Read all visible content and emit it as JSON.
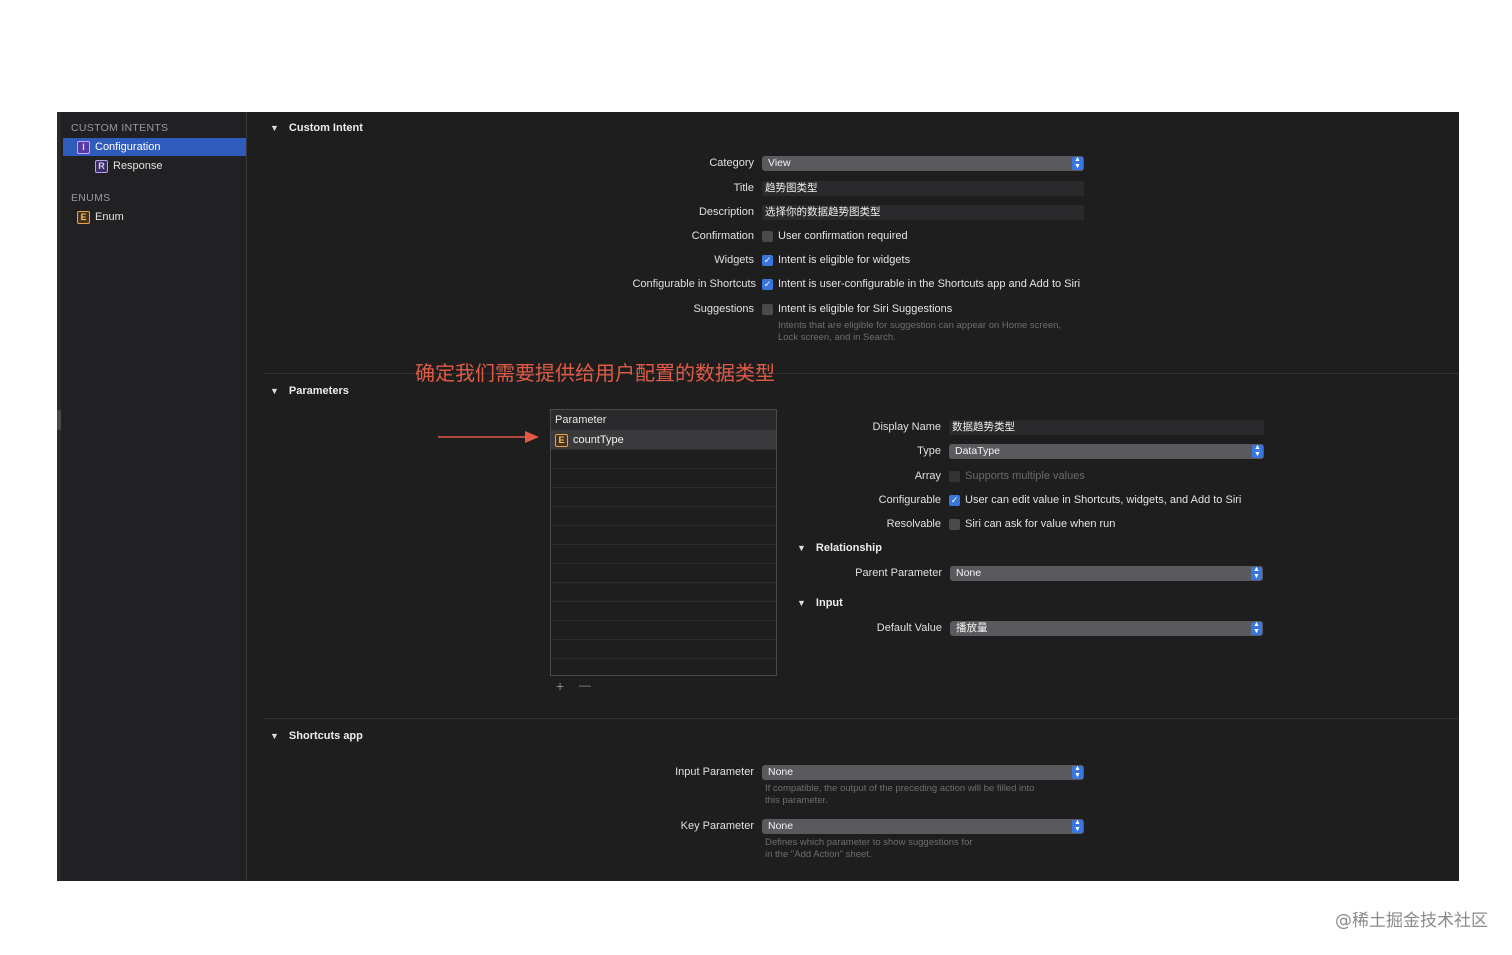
{
  "sidebar": {
    "custom_intents_header": "CUSTOM INTENTS",
    "items": [
      {
        "badge": "I",
        "label": "Configuration"
      },
      {
        "badge": "R",
        "label": "Response"
      }
    ],
    "enums_header": "ENUMS",
    "enums": [
      {
        "badge": "E",
        "label": "Enum"
      }
    ]
  },
  "custom_intent": {
    "header": "Custom Intent",
    "category_label": "Category",
    "category_value": "View",
    "title_label": "Title",
    "title_value": "趋势图类型",
    "description_label": "Description",
    "description_value": "选择你的数据趋势图类型",
    "confirmation_label": "Confirmation",
    "confirmation_text": "User confirmation required",
    "confirmation_checked": false,
    "widgets_label": "Widgets",
    "widgets_text": "Intent is eligible for widgets",
    "widgets_checked": true,
    "configurable_label": "Configurable in Shortcuts",
    "configurable_text": "Intent is user-configurable in the Shortcuts app and Add to Siri",
    "configurable_checked": true,
    "suggestions_label": "Suggestions",
    "suggestions_text": "Intent is eligible for Siri Suggestions",
    "suggestions_checked": false,
    "suggestions_hint_1": "Intents that are eligible for suggestion can appear on Home screen,",
    "suggestions_hint_2": "Lock screen, and in Search."
  },
  "annotation": {
    "text": "确定我们需要提供给用户配置的数据类型",
    "color": "#e05a45"
  },
  "parameters": {
    "header": "Parameters",
    "table_header": "Parameter",
    "rows": [
      {
        "badge": "E",
        "name": "countType"
      }
    ],
    "add_label": "+",
    "remove_label": "—",
    "display_name_label": "Display Name",
    "display_name_value": "数据趋势类型",
    "type_label": "Type",
    "type_value": "DataType",
    "array_label": "Array",
    "array_text": "Supports multiple values",
    "configurable_label": "Configurable",
    "configurable_text": "User can edit value in Shortcuts, widgets, and Add to Siri",
    "resolvable_label": "Resolvable",
    "resolvable_text": "Siri can ask for value when run",
    "relationship_header": "Relationship",
    "parent_parameter_label": "Parent Parameter",
    "parent_parameter_value": "None",
    "input_header": "Input",
    "default_value_label": "Default Value",
    "default_value_value": "播放量"
  },
  "shortcuts_app": {
    "header": "Shortcuts app",
    "input_parameter_label": "Input Parameter",
    "input_parameter_value": "None",
    "input_hint_1": "If compatible, the output of the preceding action will be filled into",
    "input_hint_2": "this parameter.",
    "key_parameter_label": "Key Parameter",
    "key_parameter_value": "None",
    "key_hint_1": "Defines which parameter to show suggestions for",
    "key_hint_2": "in the \"Add Action\" sheet."
  },
  "watermark": "@稀土掘金技术社区",
  "colors": {
    "accent": "#3a76e0",
    "selection": "#2f5bbd",
    "annotation": "#e05a45"
  }
}
